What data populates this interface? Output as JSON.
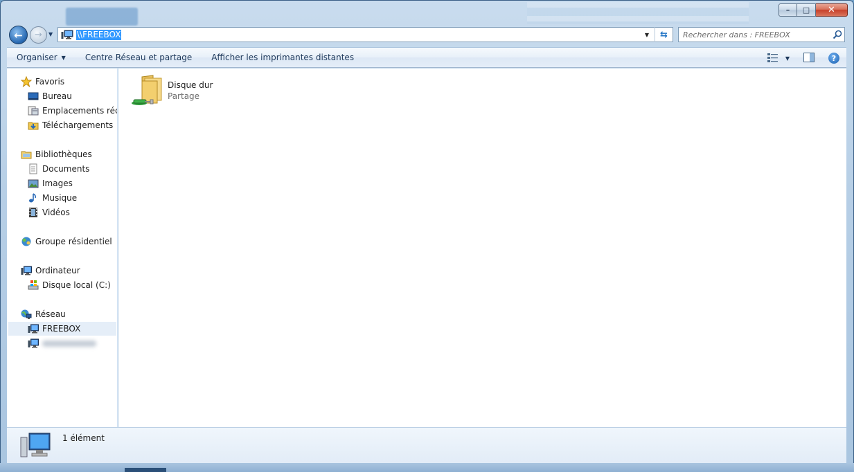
{
  "window": {
    "caption": {
      "minimize": "–",
      "maximize": "□",
      "close": "✕"
    }
  },
  "nav": {
    "back_glyph": "←",
    "forward_glyph": "→",
    "history_glyph": "▼",
    "address": "\\\\FREEBOX",
    "address_dropdown_glyph": "▼",
    "refresh_glyph": "⇆",
    "search_placeholder": "Rechercher dans : FREEBOX"
  },
  "toolbar": {
    "organize_label": "Organiser",
    "organize_caret": "▼",
    "network_center_label": "Centre Réseau et partage",
    "remote_printers_label": "Afficher les imprimantes distantes",
    "view_caret": "▼",
    "help_glyph": "?"
  },
  "sidebar": {
    "favorites": {
      "label": "Favoris",
      "items": [
        {
          "label": "Bureau",
          "icon": "desktop-icon"
        },
        {
          "label": "Emplacements récents",
          "icon": "recent-places-icon"
        },
        {
          "label": "Téléchargements",
          "icon": "downloads-icon"
        }
      ]
    },
    "libraries": {
      "label": "Bibliothèques",
      "items": [
        {
          "label": "Documents",
          "icon": "documents-icon"
        },
        {
          "label": "Images",
          "icon": "images-icon"
        },
        {
          "label": "Musique",
          "icon": "music-icon"
        },
        {
          "label": "Vidéos",
          "icon": "videos-icon"
        }
      ]
    },
    "homegroup": {
      "label": "Groupe résidentiel"
    },
    "computer": {
      "label": "Ordinateur",
      "items": [
        {
          "label": "Disque local (C:)",
          "icon": "local-disk-icon"
        }
      ]
    },
    "network": {
      "label": "Réseau",
      "items": [
        {
          "label": "FREEBOX",
          "icon": "network-computer-icon",
          "selected": true
        },
        {
          "label": "",
          "icon": "network-computer-icon",
          "blurred": true
        }
      ]
    }
  },
  "content": {
    "items": [
      {
        "name": "Disque dur",
        "subtitle": "Partage",
        "icon": "shared-folder-icon"
      }
    ]
  },
  "status": {
    "count_text": "1 élément",
    "icon": "network-computer-icon"
  },
  "colors": {
    "selection": "#3399ff",
    "tree_selected": "#e5eef8",
    "frame": "#b7cfe6"
  }
}
